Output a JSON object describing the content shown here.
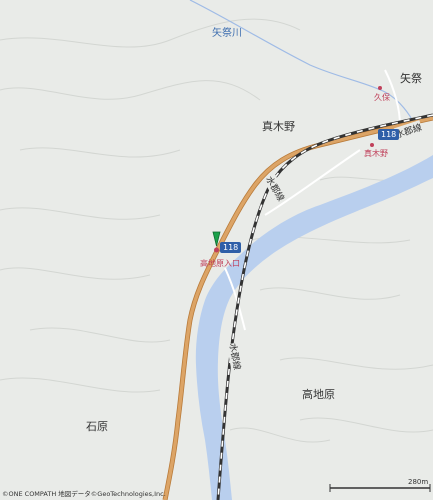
{
  "places": {
    "yamatsuri": "矢祭",
    "makino": "真木野",
    "ishihara": "石原",
    "takachihara": "高地原"
  },
  "rivers": {
    "yamatsuri_river": "矢祭川"
  },
  "railway": {
    "label_top": "水郡線",
    "label_bottom": "水郡線"
  },
  "stations_poi": {
    "kubo": "久保",
    "makino_stop": "真木野",
    "takachihara_entrance": "高地原入口"
  },
  "route": {
    "shield_1": "118",
    "shield_2": "118"
  },
  "attribution": "©ONE COMPATH 地図データ©GeoTechnologies,Inc.",
  "scale": {
    "label": "280m"
  },
  "marker": {
    "color": "#1aa14a",
    "icon": "location-pin-icon"
  },
  "colors": {
    "land": "#e9ebe8",
    "water": "#b9cfee",
    "road_main": "#dca466",
    "rail": "#333333",
    "route_shield": "#2f5fa8"
  }
}
